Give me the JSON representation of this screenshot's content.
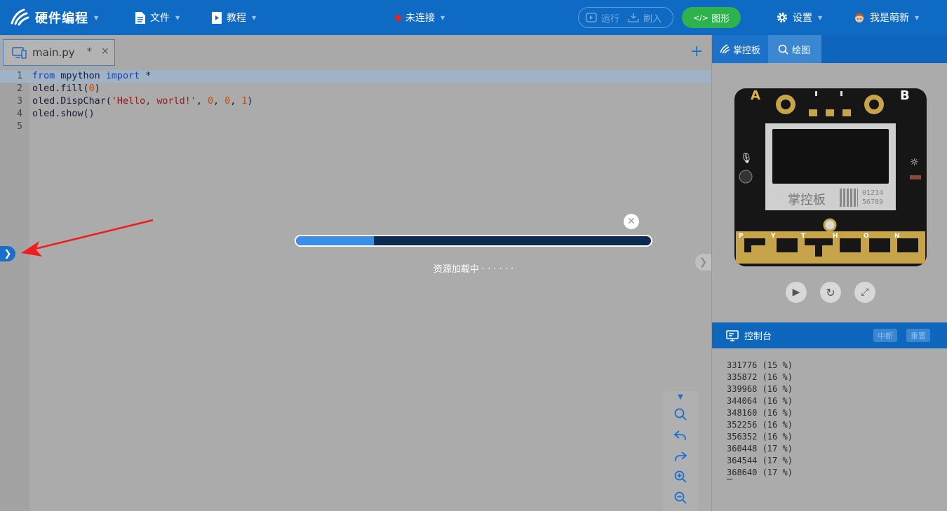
{
  "header": {
    "app_name": "硬件编程",
    "menu_file": "文件",
    "menu_tutorial": "教程",
    "connection_status": "未连接",
    "run_label": "运行",
    "flash_label": "刷入",
    "graphic_label": "图形",
    "settings_label": "设置",
    "user_name": "我是萌新"
  },
  "editor": {
    "tab_filename": "main.py",
    "tab_modified": "*",
    "tab_close": "×",
    "add_tab": "+",
    "line_numbers": [
      "1",
      "2",
      "3",
      "4",
      "5"
    ],
    "code_lines": [
      "from mpython import *",
      "oled.fill(0)",
      "oled.DispChar('Hello, world!', 0, 0, 1)",
      "oled.show()",
      ""
    ]
  },
  "loading": {
    "text": "资源加载中 · · · · · ·",
    "progress_fraction": 0.22
  },
  "right_panel": {
    "tab_board": "掌控板",
    "tab_draw": "绘图",
    "board": {
      "label_a": "A",
      "label_b": "B",
      "brand": "掌控板",
      "code_line1": "01234",
      "code_line2": "56789",
      "touch_letters": [
        "P",
        "Y",
        "T",
        "H",
        "O",
        "N"
      ]
    },
    "console": {
      "title": "控制台",
      "interrupt_label": "中断",
      "reset_label": "重置",
      "lines": [
        "331776 (15 %)",
        "335872 (16 %)",
        "339968 (16 %)",
        "344064 (16 %)",
        "348160 (16 %)",
        "352256 (16 %)",
        "356352 (16 %)",
        "360448 (17 %)",
        "364544 (17 %)",
        "368640 (17 %)"
      ]
    }
  },
  "colors": {
    "header_bg": "#0f6ac4",
    "graphic_button": "#2db24e",
    "status_dot": "#e8231d",
    "progress_fill": "#3a8ee8",
    "annotation_arrow": "#f21c1c"
  }
}
